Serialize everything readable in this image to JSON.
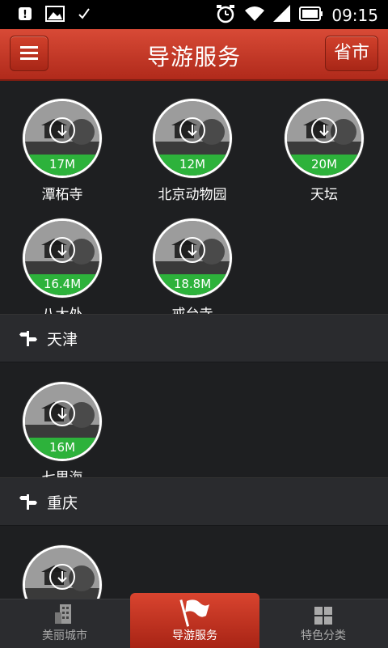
{
  "status_bar": {
    "time": "09:15"
  },
  "header": {
    "title": "导游服务",
    "province_button": "省市"
  },
  "sections": [
    {
      "title": null,
      "items": [
        {
          "name": "潭柘寺",
          "size": "17M"
        },
        {
          "name": "北京动物园",
          "size": "12M"
        },
        {
          "name": "天坛",
          "size": "20M"
        },
        {
          "name": "八大处",
          "size": "16.4M"
        },
        {
          "name": "戒台寺",
          "size": "18.8M"
        }
      ]
    },
    {
      "title": "天津",
      "items": [
        {
          "name": "七里海",
          "size": "16M"
        }
      ]
    },
    {
      "title": "重庆",
      "items": [
        {
          "name": "",
          "size": ""
        }
      ]
    }
  ],
  "tabs": [
    {
      "label": "美丽城市",
      "icon": "building-icon",
      "active": false
    },
    {
      "label": "导游服务",
      "icon": "flag-icon",
      "active": true
    },
    {
      "label": "特色分类",
      "icon": "grid-icon",
      "active": false
    }
  ]
}
